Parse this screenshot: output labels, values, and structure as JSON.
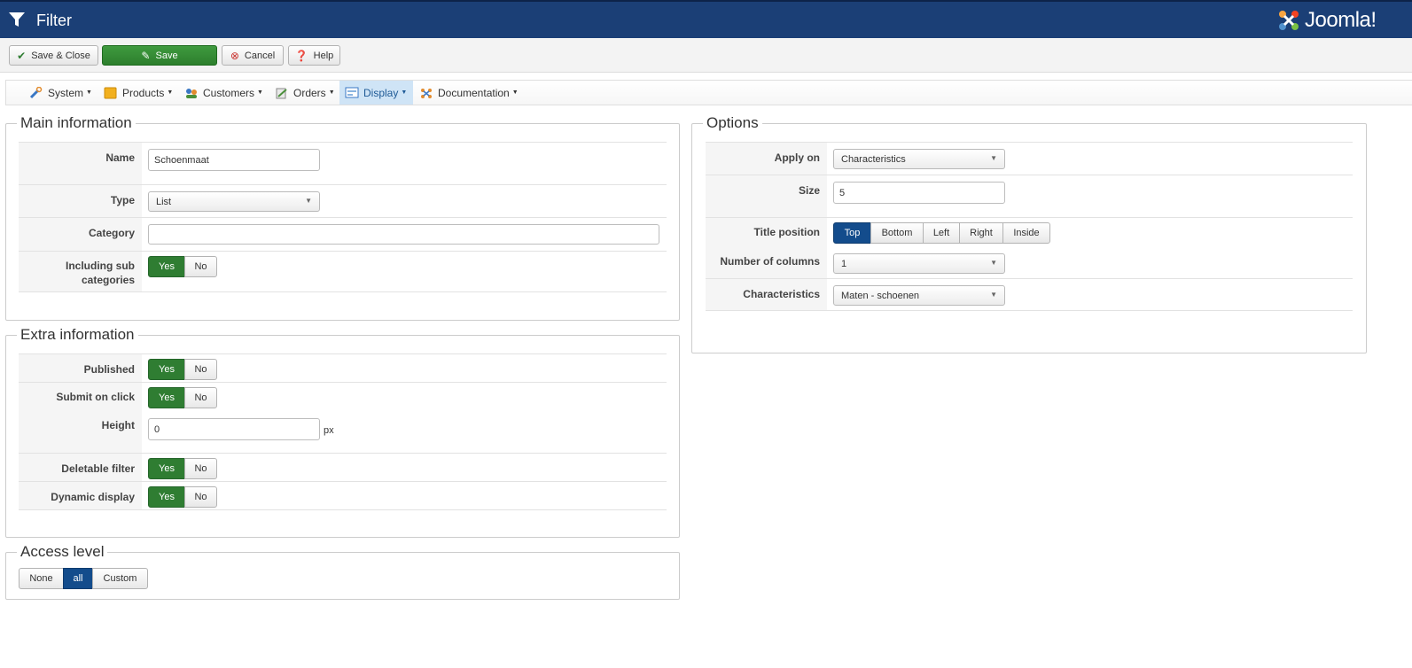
{
  "header": {
    "title": "Filter",
    "logo_text": "Joomla!"
  },
  "toolbar": {
    "save_close": "Save & Close",
    "save": "Save",
    "cancel": "Cancel",
    "help": "Help"
  },
  "menu": {
    "items": [
      {
        "label": "System"
      },
      {
        "label": "Products"
      },
      {
        "label": "Customers"
      },
      {
        "label": "Orders"
      },
      {
        "label": "Display"
      },
      {
        "label": "Documentation"
      }
    ]
  },
  "main_info": {
    "legend": "Main information",
    "name_label": "Name",
    "name_value": "Schoenmaat",
    "type_label": "Type",
    "type_value": "List",
    "category_label": "Category",
    "category_value": "",
    "sub_label_1": "Including sub",
    "sub_label_2": "categories",
    "yes": "Yes",
    "no": "No"
  },
  "extra_info": {
    "legend": "Extra information",
    "published_label": "Published",
    "submit_label": "Submit on click",
    "height_label": "Height",
    "height_value": "0",
    "height_unit": "px",
    "deletable_label": "Deletable filter",
    "dynamic_label": "Dynamic display",
    "yes": "Yes",
    "no": "No"
  },
  "access": {
    "legend": "Access level",
    "options": [
      "None",
      "all",
      "Custom"
    ],
    "selected": "all"
  },
  "options": {
    "legend": "Options",
    "apply_label": "Apply on",
    "apply_value": "Characteristics",
    "size_label": "Size",
    "size_value": "5",
    "title_pos_label": "Title position",
    "title_pos_options": [
      "Top",
      "Bottom",
      "Left",
      "Right",
      "Inside"
    ],
    "title_pos_selected": "Top",
    "columns_label": "Number of columns",
    "columns_value": "1",
    "characteristics_label": "Characteristics",
    "characteristics_value": "Maten - schoenen"
  },
  "colors": {
    "header_bg": "#1b3f76",
    "toggle_on": "#2f7d32",
    "selected_blue": "#134c8c",
    "menu_active": "#cfe4f6"
  }
}
